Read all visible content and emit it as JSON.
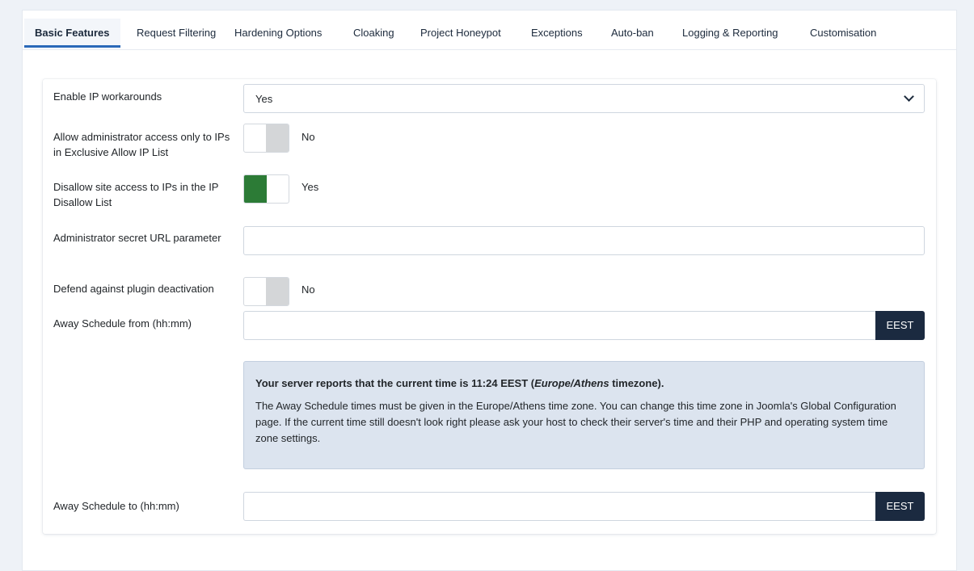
{
  "tabs": [
    {
      "label": "Basic Features",
      "active": true
    },
    {
      "label": "Request Filtering"
    },
    {
      "label": "Hardening Options"
    },
    {
      "label": "Cloaking"
    },
    {
      "label": "Project Honeypot"
    },
    {
      "label": "Exceptions"
    },
    {
      "label": "Auto-ban"
    },
    {
      "label": "Logging & Reporting"
    },
    {
      "label": "Customisation"
    }
  ],
  "fields": {
    "ip_workarounds": {
      "label": "Enable IP workarounds",
      "value": "Yes"
    },
    "admin_exclusive": {
      "label": "Allow administrator access only to IPs in Exclusive Allow IP List",
      "state": "No"
    },
    "disallow_list": {
      "label": "Disallow site access to IPs in the IP Disallow List",
      "state": "Yes"
    },
    "secret_url": {
      "label": "Administrator secret URL parameter",
      "value": ""
    },
    "plugin_deactivation": {
      "label": "Defend against plugin deactivation",
      "state": "No"
    },
    "away_from": {
      "label": "Away Schedule from (hh:mm)",
      "value": "",
      "addon": "EEST"
    },
    "away_to": {
      "label": "Away Schedule to (hh:mm)",
      "value": "",
      "addon": "EEST"
    }
  },
  "alert": {
    "head_pre": "Your server reports that the current time is ",
    "head_time": "11:24 EEST",
    "head_mid": " (",
    "head_tz": "Europe/Athens",
    "head_post": " timezone).",
    "body": "The Away Schedule times must be given in the Europe/Athens time zone. You can change this time zone in Joomla's Global Configuration page. If the current time still doesn't look right please ask your host to check their server's time and their PHP and operating system time zone settings."
  },
  "colors": {
    "toggle_on": "#2c7b36",
    "toggle_off": "#d4d6d8",
    "addon_bg": "#1b2a40",
    "tab_underline": "#2a69b8",
    "alert_bg": "#dce4ef"
  }
}
